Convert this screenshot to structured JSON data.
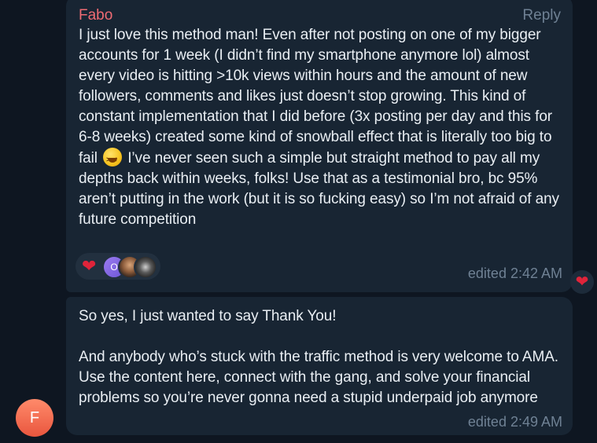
{
  "message1": {
    "sender": "Fabo",
    "reply_label": "Reply",
    "text_part1": "I just love this method man! Even after not posting on one of my bigger accounts for 1 week (I didn’t find my smartphone anymore lol) almost every video is hitting >10k views within hours and the amount of new followers, comments and likes just doesn’t stop growing. This kind of constant implementation that I did before (3x posting per day and this for 6-8 weeks) created some kind of snowball effect that is literally too big to fail",
    "emoji_name": "laughing-squint-emoji",
    "text_part2": " I’ve never seen such a simple but straight method to pay all my depths back within weeks, folks! Use that as a testimonial bro, bc 95% aren’t putting in the work (but it is so fucking easy) so I’m not afraid of any future competition",
    "reactions": {
      "heart": "❤",
      "reactor_initial": "O",
      "reactor_icons": [
        "purple-avatar-o",
        "photo-avatar",
        "dark-avatar"
      ]
    },
    "time": "edited 2:42 AM",
    "side_reaction": "❤"
  },
  "message2": {
    "text": "So yes, I just wanted to say Thank You!\n\nAnd anybody who’s stuck with the traffic method is very welcome to AMA. Use the content here, connect with the gang, and solve your financial problems so you’re never gonna need a stupid underpaid job anymore",
    "time": "edited 2:49 AM"
  },
  "user_avatar": {
    "initial": "F",
    "color": "#ef6b4e"
  },
  "colors": {
    "background": "#0e1621",
    "bubble": "#182533",
    "sender_name": "#ef6b73",
    "meta_text": "#6f8194",
    "heart": "#e0243a"
  }
}
